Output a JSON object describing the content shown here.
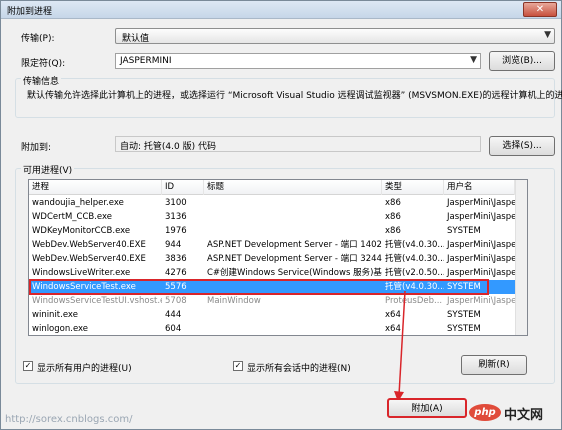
{
  "window": {
    "title": "附加到进程",
    "close_label": "✕"
  },
  "transport": {
    "label": "传输(P):",
    "value": "默认值",
    "arrow": "▼"
  },
  "qualifier": {
    "label": "限定符(Q):",
    "value": "JASPERMINI",
    "arrow": "▼",
    "browse_label": "浏览(B)..."
  },
  "transport_info": {
    "label": "传输信息",
    "text": "默认传输允许选择此计算机上的进程，或选择运行 “Microsoft Visual Studio 远程调试监视器” (MSVSMON.EXE)的远程计算机上的进程。"
  },
  "attach_to": {
    "label": "附加到:",
    "value": "自动: 托管(4.0 版) 代码",
    "select_label": "选择(S)..."
  },
  "available": {
    "label": "可用进程(V)",
    "columns": [
      "进程",
      "ID",
      "标题",
      "类型",
      "用户名"
    ],
    "rows": [
      {
        "name": "wandoujia_helper.exe",
        "id": "3100",
        "title": "",
        "type": "x86",
        "user": "JasperMini\\Jasper..."
      },
      {
        "name": "WDCertM_CCB.exe",
        "id": "3136",
        "title": "",
        "type": "x86",
        "user": "JasperMini\\Jasper..."
      },
      {
        "name": "WDKeyMonitorCCB.exe",
        "id": "1976",
        "title": "",
        "type": "x86",
        "user": "SYSTEM"
      },
      {
        "name": "WebDev.WebServer40.EXE",
        "id": "944",
        "title": "ASP.NET Development Server - 端口 1402",
        "type": "托管(v4.0.30...",
        "user": "JasperMini\\Jasper..."
      },
      {
        "name": "WebDev.WebServer40.EXE",
        "id": "3836",
        "title": "ASP.NET Development Server - 端口 3244",
        "type": "托管(v4.0.30...",
        "user": "JasperMini\\Jasper..."
      },
      {
        "name": "WindowsLiveWriter.exe",
        "id": "4276",
        "title": "C#创建Windows Service(Windows 服务)基础...",
        "type": "托管(v2.0.50...",
        "user": "JasperMini\\Jasper..."
      },
      {
        "name": "WindowsServiceTest.exe",
        "id": "5576",
        "title": "",
        "type": "托管(v4.0.30...",
        "user": "SYSTEM"
      },
      {
        "name": "WindowsServiceTestUI.vshost.exe",
        "id": "5708",
        "title": "MainWindow",
        "type": "ProteusDeb...",
        "user": "JasperMini\\Jasper..."
      },
      {
        "name": "wininit.exe",
        "id": "444",
        "title": "",
        "type": "x64",
        "user": "SYSTEM"
      },
      {
        "name": "winlogon.exe",
        "id": "604",
        "title": "",
        "type": "x64",
        "user": "SYSTEM"
      }
    ]
  },
  "options": {
    "all_users_label": "显示所有用户的进程(U)",
    "all_sessions_label": "显示所有会话中的进程(N)",
    "refresh_label": "刷新(R)",
    "check_mark": "✓"
  },
  "footer": {
    "attach_label": "附加(A)",
    "watermark": "http://sorex.cnblogs.com/",
    "php_logo": "php",
    "php_text": "中文网"
  }
}
